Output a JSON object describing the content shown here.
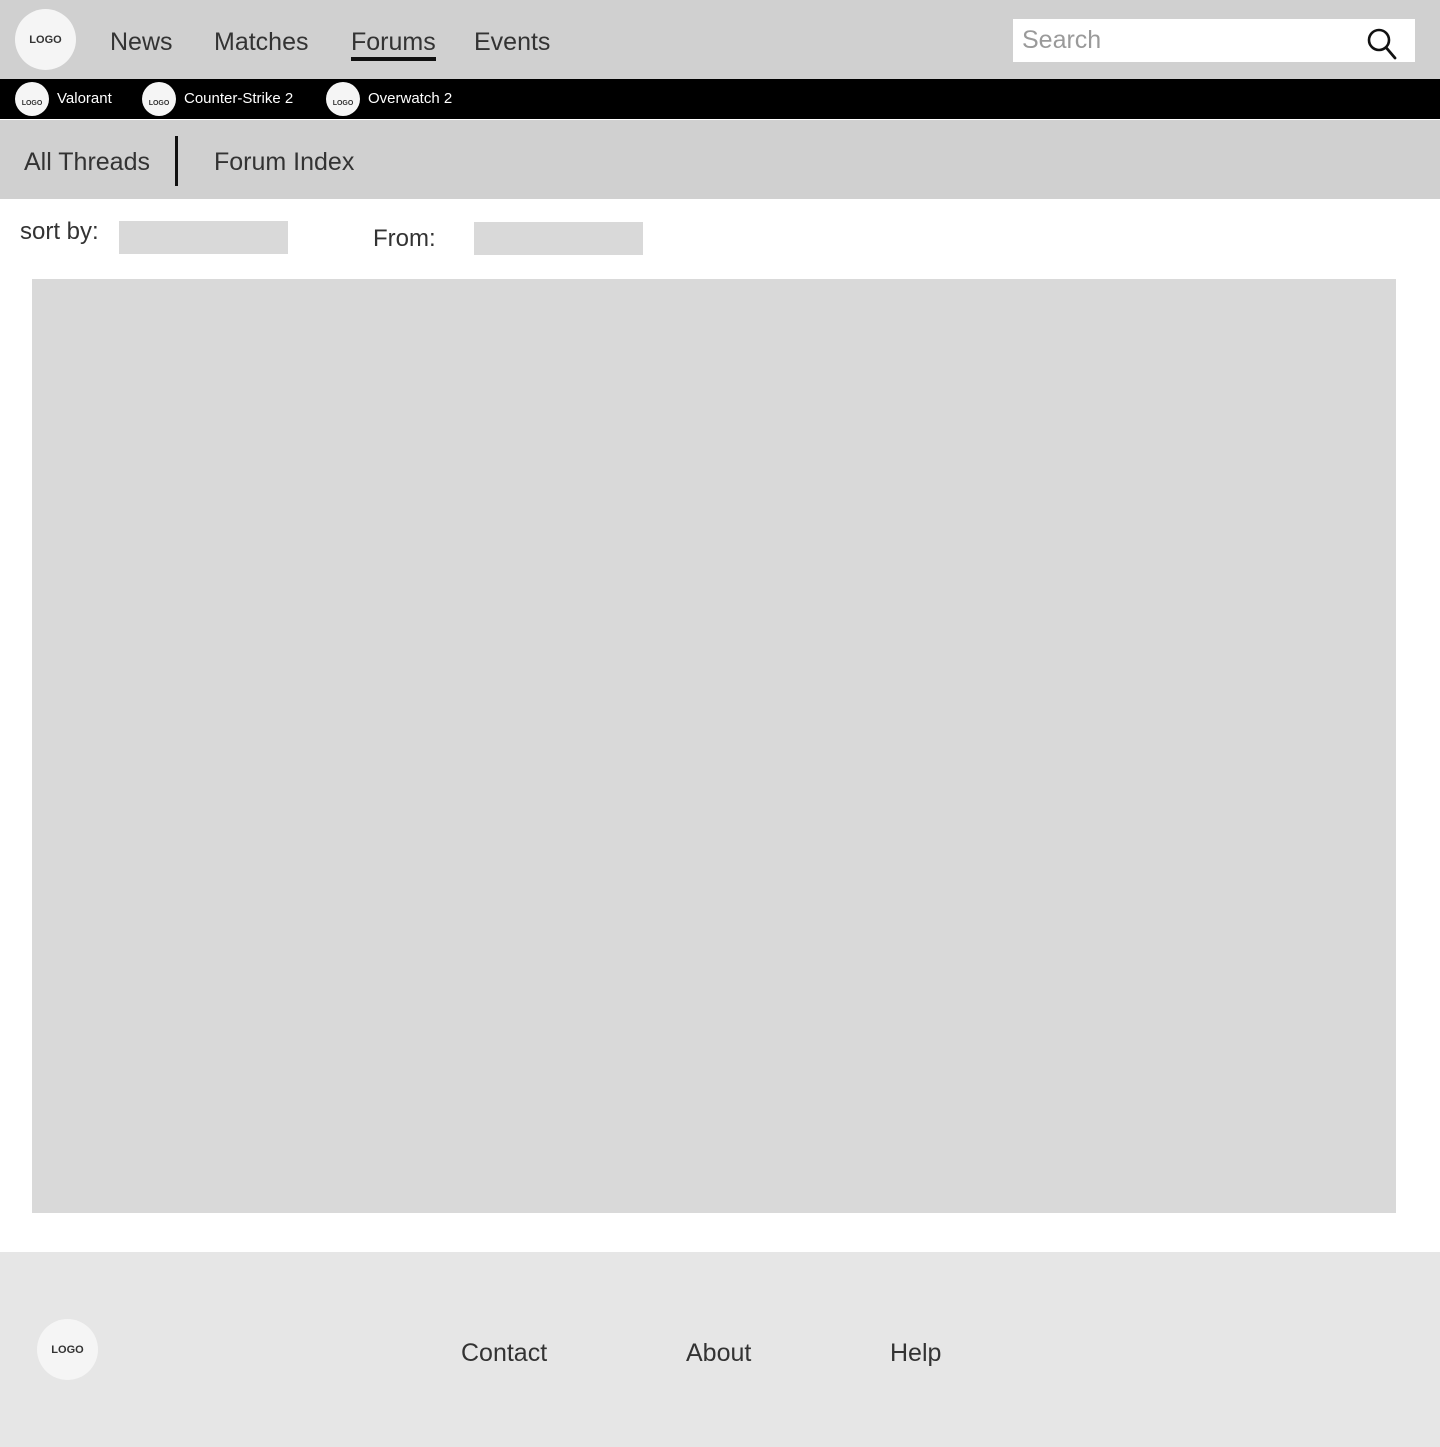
{
  "header": {
    "logo_text": "LOGO",
    "nav": [
      {
        "label": "News",
        "active": false
      },
      {
        "label": "Matches",
        "active": false
      },
      {
        "label": "Forums",
        "active": true
      },
      {
        "label": "Events",
        "active": false
      }
    ],
    "search": {
      "placeholder": "Search",
      "value": "",
      "icon": "search-icon"
    }
  },
  "games": [
    {
      "logo_text": "LOGO",
      "label": "Valorant"
    },
    {
      "logo_text": "LOGO",
      "label": "Counter-Strike 2"
    },
    {
      "logo_text": "LOGO",
      "label": "Overwatch 2"
    }
  ],
  "forum_tabs": [
    {
      "label": "All Threads"
    },
    {
      "label": "Forum Index"
    }
  ],
  "filters": {
    "sort_by_label": "sort by:",
    "sort_by_value": "",
    "from_label": "From:",
    "from_value": ""
  },
  "footer": {
    "logo_text": "LOGO",
    "links": [
      {
        "label": "Contact"
      },
      {
        "label": "About"
      },
      {
        "label": "Help"
      }
    ]
  },
  "colors": {
    "header_bg": "#d0d0d0",
    "game_bar_bg": "#000000",
    "placeholder_block": "#d9d9d9",
    "footer_bg": "#e6e6e6",
    "text": "#333333"
  }
}
